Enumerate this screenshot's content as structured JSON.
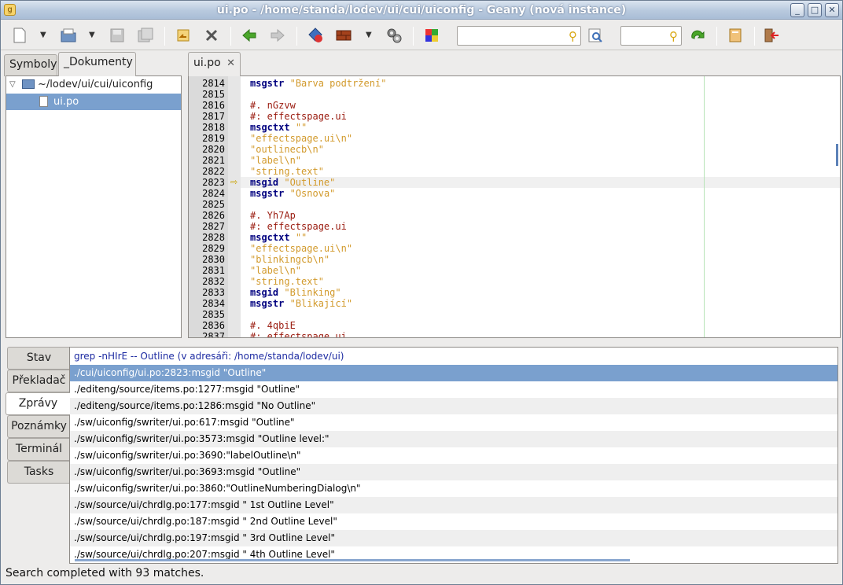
{
  "window": {
    "title": "ui.po - /home/standa/lodev/ui/cui/uiconfig - Geany (nová instance)",
    "app_icon": "geany-icon"
  },
  "toolbar": {
    "search_value": "",
    "goto_value": ""
  },
  "sidebar": {
    "tabs": [
      "Symboly",
      "_Dokumenty"
    ],
    "active_tab": "_Dokumenty",
    "tree": {
      "folder": "~/lodev/ui/cui/uiconfig",
      "file": "ui.po"
    }
  },
  "editor": {
    "tab_label": "ui.po",
    "current_line": 2823,
    "lines": [
      {
        "n": "2814",
        "parts": [
          [
            "k",
            "msgstr"
          ],
          [
            "p",
            " "
          ],
          [
            "s",
            "\"Barva podtržení\""
          ]
        ]
      },
      {
        "n": "2815",
        "parts": []
      },
      {
        "n": "2816",
        "parts": [
          [
            "c",
            "#. nGzvw"
          ]
        ]
      },
      {
        "n": "2817",
        "parts": [
          [
            "c",
            "#: effectspage.ui"
          ]
        ]
      },
      {
        "n": "2818",
        "parts": [
          [
            "k",
            "msgctxt"
          ],
          [
            "p",
            " "
          ],
          [
            "s",
            "\"\""
          ]
        ]
      },
      {
        "n": "2819",
        "parts": [
          [
            "s",
            "\"effectspage.ui\\n\""
          ]
        ]
      },
      {
        "n": "2820",
        "parts": [
          [
            "s",
            "\"outlinecb\\n\""
          ]
        ]
      },
      {
        "n": "2821",
        "parts": [
          [
            "s",
            "\"label\\n\""
          ]
        ]
      },
      {
        "n": "2822",
        "parts": [
          [
            "s",
            "\"string.text\""
          ]
        ]
      },
      {
        "n": "2823",
        "parts": [
          [
            "k",
            "msgid"
          ],
          [
            "p",
            " "
          ],
          [
            "s",
            "\"Outline\""
          ]
        ]
      },
      {
        "n": "2824",
        "parts": [
          [
            "k",
            "msgstr"
          ],
          [
            "p",
            " "
          ],
          [
            "s",
            "\"Osnova\""
          ]
        ]
      },
      {
        "n": "2825",
        "parts": []
      },
      {
        "n": "2826",
        "parts": [
          [
            "c",
            "#. Yh7Ap"
          ]
        ]
      },
      {
        "n": "2827",
        "parts": [
          [
            "c",
            "#: effectspage.ui"
          ]
        ]
      },
      {
        "n": "2828",
        "parts": [
          [
            "k",
            "msgctxt"
          ],
          [
            "p",
            " "
          ],
          [
            "s",
            "\"\""
          ]
        ]
      },
      {
        "n": "2829",
        "parts": [
          [
            "s",
            "\"effectspage.ui\\n\""
          ]
        ]
      },
      {
        "n": "2830",
        "parts": [
          [
            "s",
            "\"blinkingcb\\n\""
          ]
        ]
      },
      {
        "n": "2831",
        "parts": [
          [
            "s",
            "\"label\\n\""
          ]
        ]
      },
      {
        "n": "2832",
        "parts": [
          [
            "s",
            "\"string.text\""
          ]
        ]
      },
      {
        "n": "2833",
        "parts": [
          [
            "k",
            "msgid"
          ],
          [
            "p",
            " "
          ],
          [
            "s",
            "\"Blinking\""
          ]
        ]
      },
      {
        "n": "2834",
        "parts": [
          [
            "k",
            "msgstr"
          ],
          [
            "p",
            " "
          ],
          [
            "s",
            "\"Blikající\""
          ]
        ]
      },
      {
        "n": "2835",
        "parts": []
      },
      {
        "n": "2836",
        "parts": [
          [
            "c",
            "#. 4qbiE"
          ]
        ]
      },
      {
        "n": "2837",
        "parts": [
          [
            "c",
            "#: effectspage.ui"
          ]
        ]
      }
    ]
  },
  "bottom": {
    "tabs": [
      "Stav",
      "Překladač",
      "Zprávy",
      "Poznámky",
      "Terminál",
      "Tasks"
    ],
    "active_tab": "Zprávy",
    "messages": [
      "grep -nHIrE -- Outline (v adresáři: /home/standa/lodev/ui)",
      "./cui/uiconfig/ui.po:2823:msgid \"Outline\"",
      "./editeng/source/items.po:1277:msgid \"Outline\"",
      "./editeng/source/items.po:1286:msgid \"No Outline\"",
      "./sw/uiconfig/swriter/ui.po:617:msgid \"Outline\"",
      "./sw/uiconfig/swriter/ui.po:3573:msgid \"Outline level:\"",
      "./sw/uiconfig/swriter/ui.po:3690:\"labelOutline\\n\"",
      "./sw/uiconfig/swriter/ui.po:3693:msgid \"Outline\"",
      "./sw/uiconfig/swriter/ui.po:3860:\"OutlineNumberingDialog\\n\"",
      "./sw/source/ui/chrdlg.po:177:msgid \" 1st Outline Level\"",
      "./sw/source/ui/chrdlg.po:187:msgid \" 2nd Outline Level\"",
      "./sw/source/ui/chrdlg.po:197:msgid \" 3rd Outline Level\"",
      "./sw/source/ui/chrdlg.po:207:msgid \" 4th Outline Level\""
    ],
    "selected_index": 1
  },
  "status": {
    "text": "Search completed with 93 matches."
  }
}
